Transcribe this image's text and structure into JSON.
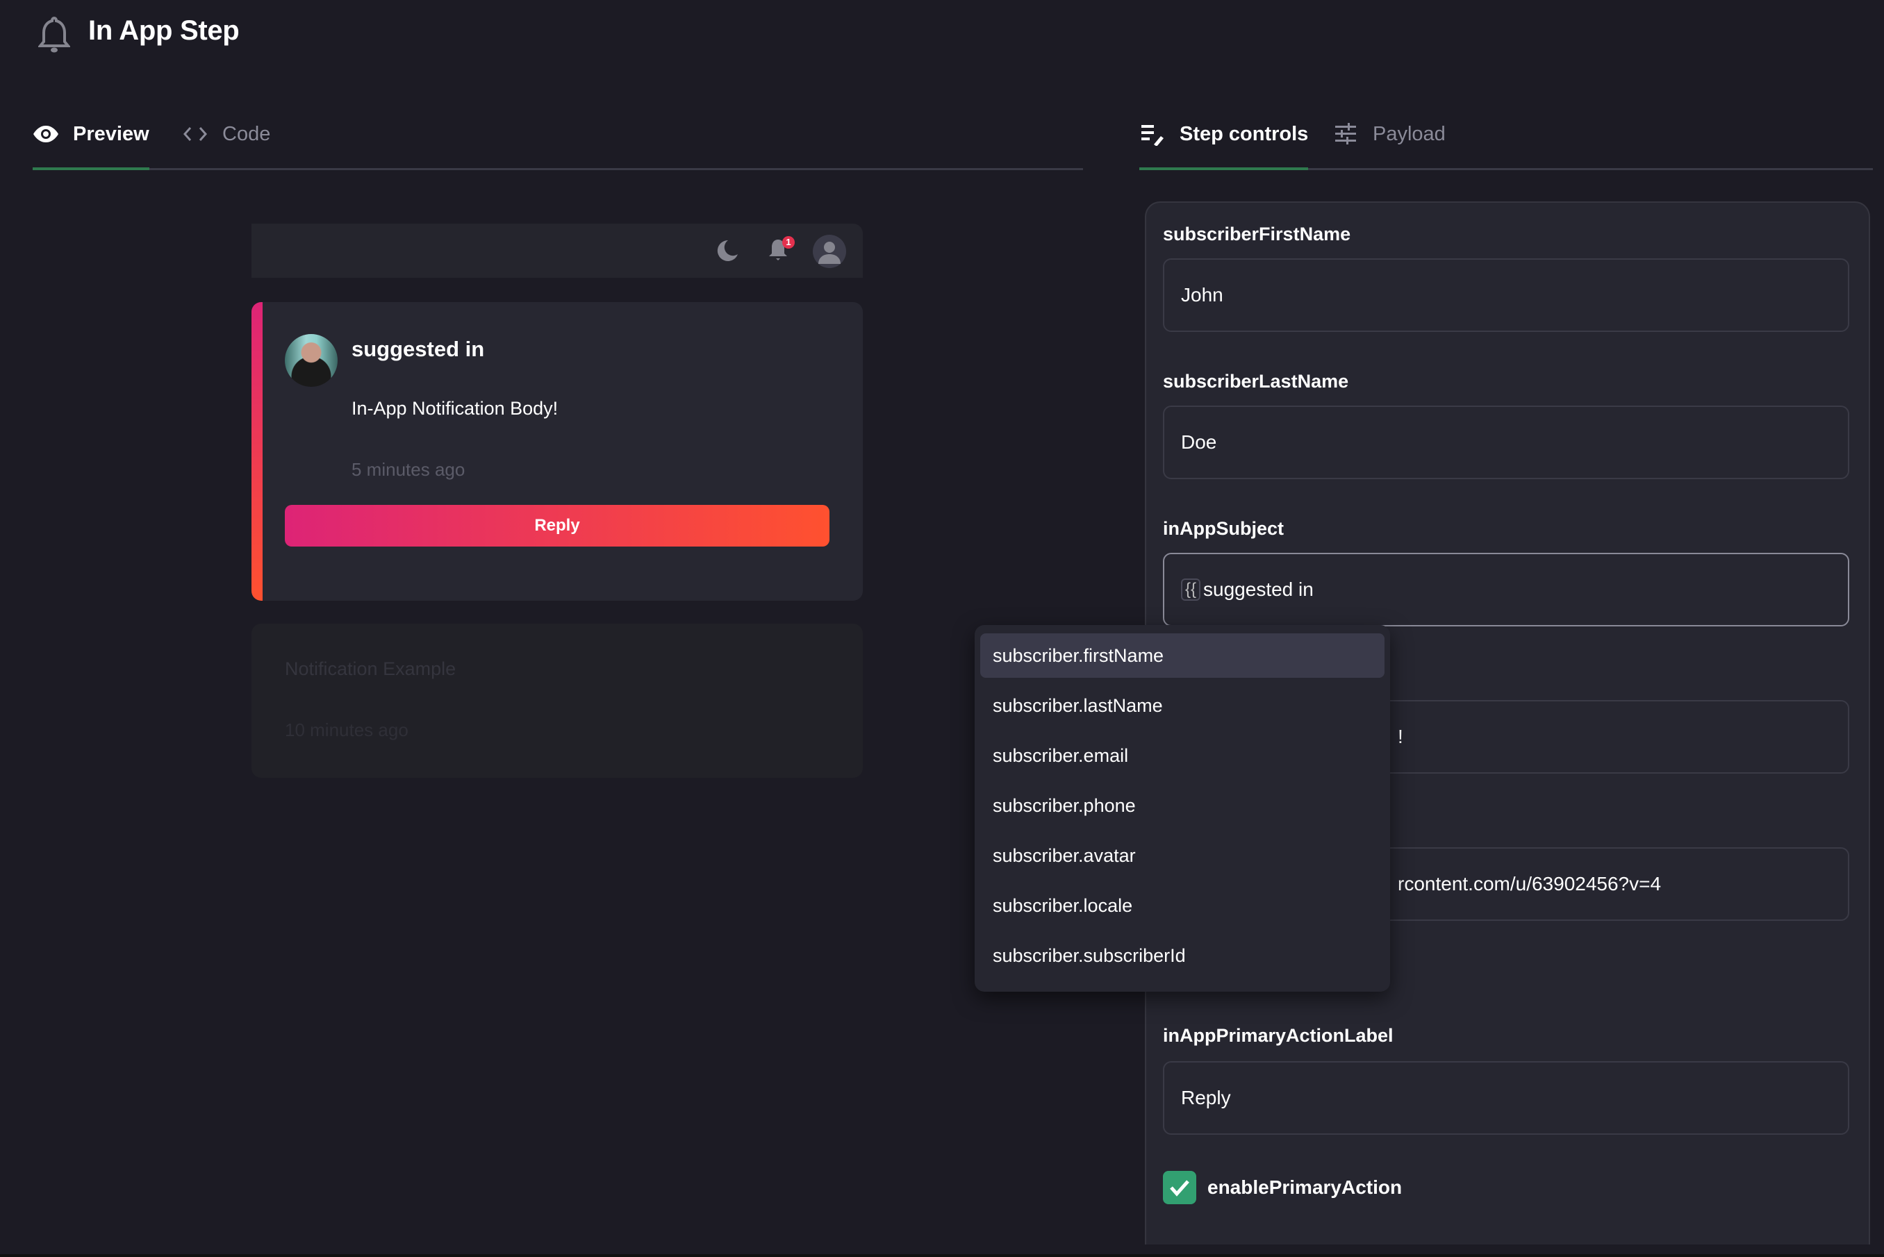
{
  "header": {
    "icon": "bell-icon",
    "title": "In App Step"
  },
  "left_tabs": [
    {
      "label": "Preview",
      "icon": "eye-icon",
      "active": true
    },
    {
      "label": "Code",
      "icon": "code-icon",
      "active": false
    }
  ],
  "right_tabs": [
    {
      "label": "Step controls",
      "icon": "edit-list-icon",
      "active": true
    },
    {
      "label": "Payload",
      "icon": "sliders-icon",
      "active": false
    }
  ],
  "preview": {
    "inbox_header": {
      "badge_count": "1"
    },
    "notification": {
      "subject": "suggested in",
      "body": "In-App Notification Body!",
      "time": "5 minutes ago",
      "primary_action": "Reply",
      "accent_gradient": [
        "#dd2476",
        "#ff512f"
      ]
    },
    "example_notification": {
      "title": "Notification Example",
      "time": "10 minutes ago"
    }
  },
  "controls": {
    "fields": [
      {
        "label": "subscriberFirstName",
        "value": "John"
      },
      {
        "label": "subscriberLastName",
        "value": "Doe"
      },
      {
        "label": "inAppSubject",
        "chip": "{{",
        "value": "suggested in"
      },
      {
        "label": "",
        "value": "!"
      },
      {
        "label": "",
        "value": "rcontent.com/u/63902456?v=4"
      },
      {
        "label": "inAppPrimaryActionLabel",
        "value": "Reply"
      }
    ],
    "checkbox": {
      "label": "enablePrimaryAction",
      "checked": true,
      "color": "#32a071"
    }
  },
  "autocomplete": {
    "items": [
      "subscriber.firstName",
      "subscriber.lastName",
      "subscriber.email",
      "subscriber.phone",
      "subscriber.avatar",
      "subscriber.locale",
      "subscriber.subscriberId"
    ],
    "highlighted_index": 0
  },
  "colors": {
    "active_tab_underline": "#2f7a4e",
    "badge": "#e4314e",
    "background": "#1c1b24"
  }
}
